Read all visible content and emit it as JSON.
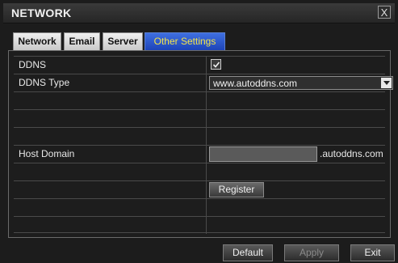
{
  "window": {
    "title": "NETWORK",
    "close_label": "X"
  },
  "tabs": [
    {
      "label": "Network",
      "active": false
    },
    {
      "label": "Email",
      "active": false
    },
    {
      "label": "Server",
      "active": false
    },
    {
      "label": "Other Settings",
      "active": true
    }
  ],
  "form": {
    "ddns_label": "DDNS",
    "ddns_checked": true,
    "ddns_type_label": "DDNS Type",
    "ddns_type_value": "www.autoddns.com",
    "host_domain_label": "Host Domain",
    "host_domain_value": "",
    "host_domain_suffix": ".autoddns.com",
    "register_label": "Register"
  },
  "footer": {
    "default_label": "Default",
    "apply_label": "Apply",
    "apply_enabled": false,
    "exit_label": "Exit"
  },
  "colors": {
    "active_tab": "#1d44b8",
    "active_tab_text": "#f2e34a"
  }
}
